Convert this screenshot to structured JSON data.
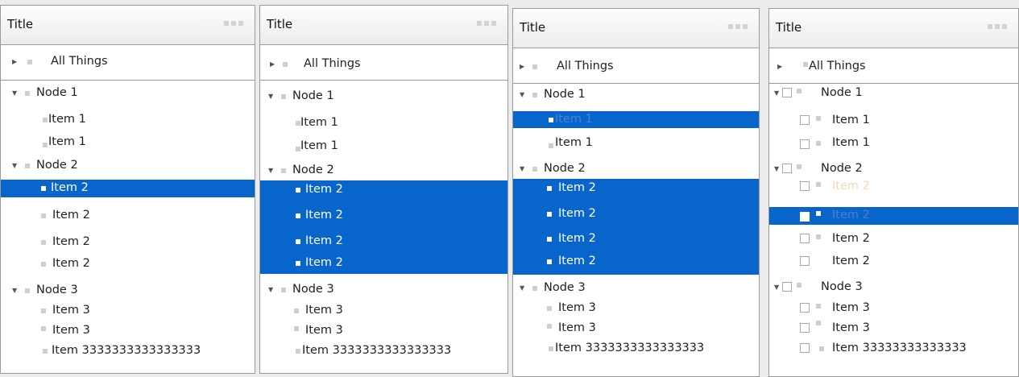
{
  "panels": [
    {
      "title": "Title",
      "root_label": "All Things",
      "node1": "Node 1",
      "item1a": "Item 1",
      "item1b": "Item 1",
      "node2": "Node 2",
      "item2a": "Item 2",
      "item2b": "Item 2",
      "item2c": "Item 2",
      "item2d": "Item 2",
      "node3": "Node 3",
      "item3a": "Item 3",
      "item3b": "Item 3",
      "item3c": "Item 3333333333333333"
    },
    {
      "title": "Title",
      "root_label": "All Things",
      "node1": "Node 1",
      "item1a": "Item 1",
      "item1b": "Item 1",
      "node2": "Node 2",
      "item2a": "Item 2",
      "item2b": "Item 2",
      "item2c": "Item 2",
      "item2d": "Item 2",
      "node3": "Node 3",
      "item3a": "Item 3",
      "item3b": "Item 3",
      "item3c": "Item 3333333333333333"
    },
    {
      "title": "Title",
      "root_label": "All Things",
      "node1": "Node 1",
      "item1a": "Item 1",
      "item1b": "Item 1",
      "node2": "Node 2",
      "item2a": "Item 2",
      "item2b": "Item 2",
      "item2c": "Item 2",
      "item2d": "Item 2",
      "node3": "Node 3",
      "item3a": "Item 3",
      "item3b": "Item 3",
      "item3c": "Item 3333333333333333"
    },
    {
      "title": "Title",
      "root_label": "All Things",
      "node1": "Node 1",
      "item1a": "Item 1",
      "item1b": "Item 1",
      "node2": "Node 2",
      "item2a": "Item 2",
      "item2b": "Item 2",
      "item2c": "Item 2",
      "item2d": "Item 2",
      "node3": "Node 3",
      "item3a": "Item 3",
      "item3b": "Item 3",
      "item3c": "Item 33333333333333"
    }
  ],
  "colors": {
    "selection": "#0865cc",
    "highlight_text_dim": "#4d7fcf",
    "highlight_text_peach": "#f3d9b5"
  },
  "icons": {
    "expand": "triangle-right-icon",
    "collapse": "triangle-down-icon",
    "leaf": "square-bullet-icon",
    "check": "checkbox-icon"
  }
}
